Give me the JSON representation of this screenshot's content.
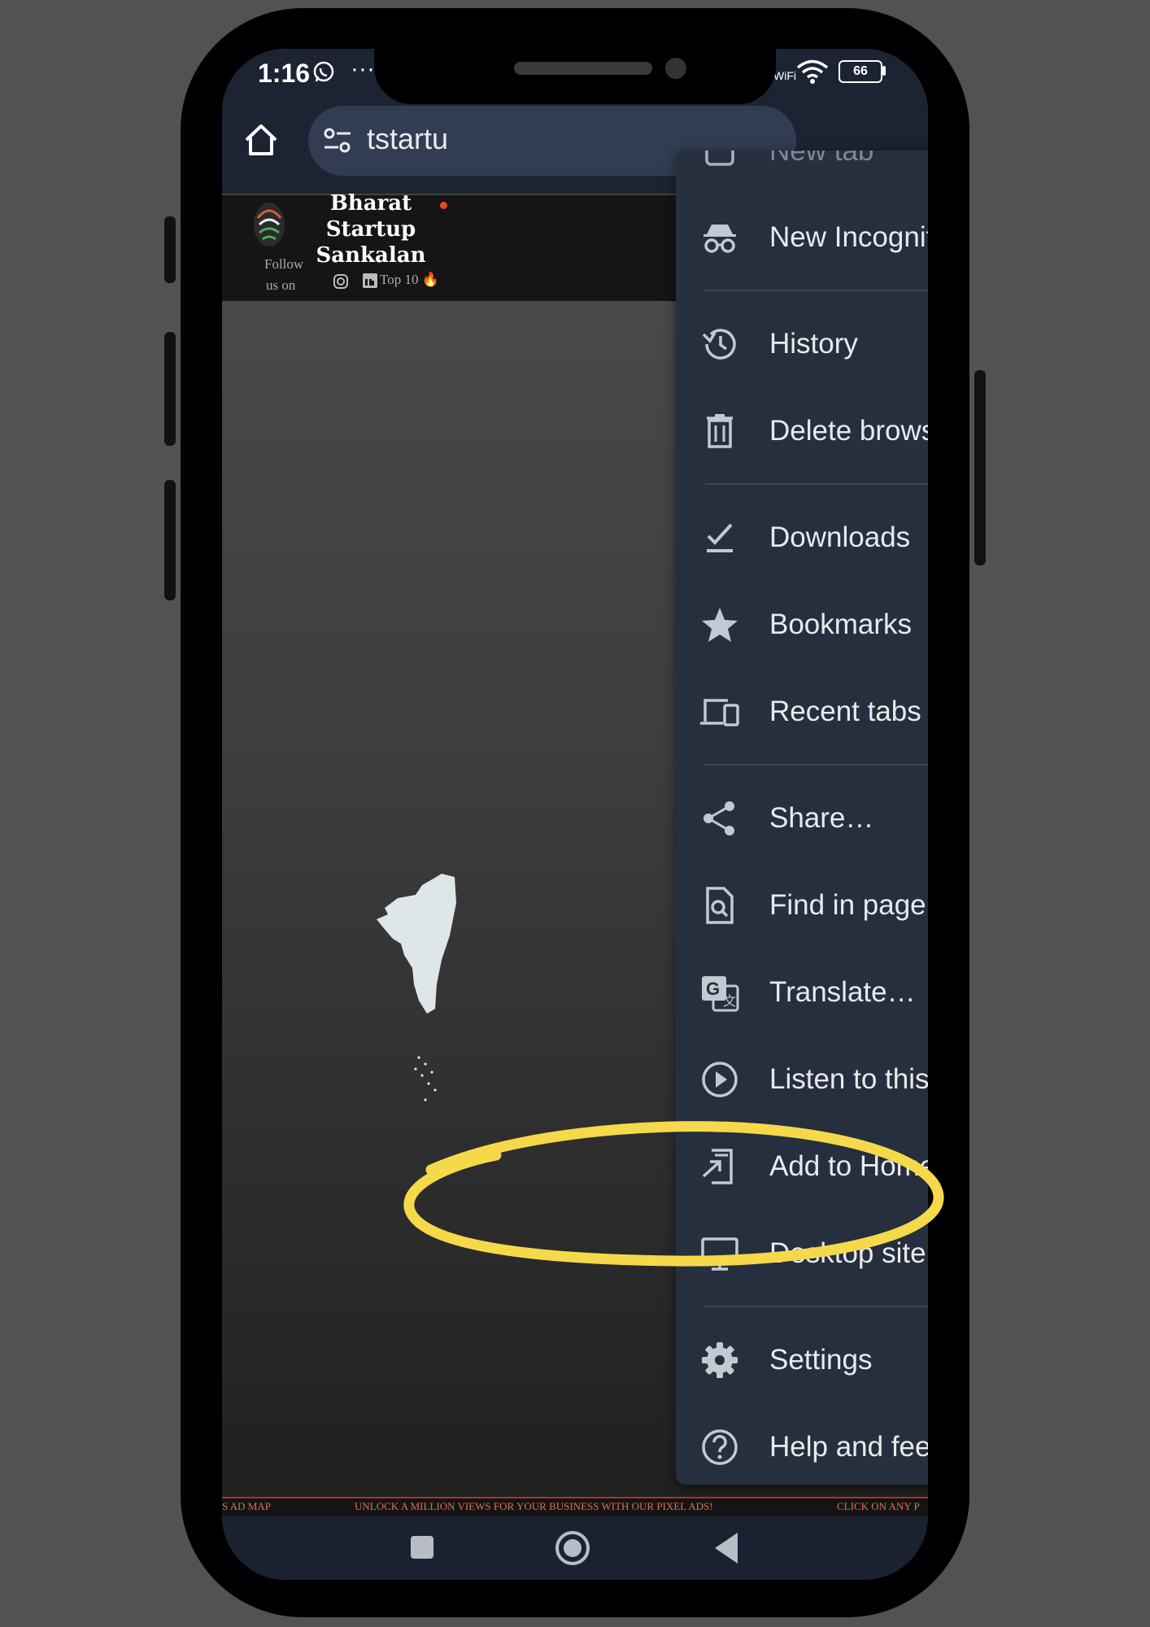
{
  "status_bar": {
    "time": "1:16",
    "more": "···",
    "wifi_label": "WiFi",
    "battery": "66"
  },
  "browser": {
    "url_text": "tstartu"
  },
  "website": {
    "title_lines": [
      "Bharat",
      "Startup",
      "Sankalan"
    ],
    "follow_line1": "Follow",
    "follow_line2": "us on",
    "top10": "Top 10 🔥",
    "ticker": {
      "left": "S AD MAP",
      "center": "UNLOCK A MILLION VIEWS FOR YOUR BUSINESS WITH OUR PIXEL ADS!",
      "right": "CLICK ON ANY P"
    }
  },
  "menu": {
    "new_tab": "New tab",
    "incognito": "New Incognito tab",
    "history": "History",
    "delete": "Delete browsing data",
    "downloads": "Downloads",
    "bookmarks": "Bookmarks",
    "recent_tabs": "Recent tabs",
    "share": "Share…",
    "find": "Find in page",
    "translate": "Translate…",
    "listen": "Listen to this page",
    "add_home": "Add to Home screen",
    "desktop_site": "Desktop site",
    "desktop_site_checked": true,
    "settings": "Settings",
    "help": "Help and feedback"
  },
  "colors": {
    "menu_bg": "#262f3e",
    "highlight": "#f5d94a",
    "whatsapp": "#25d366",
    "checkbox": "#a8c7fa"
  }
}
